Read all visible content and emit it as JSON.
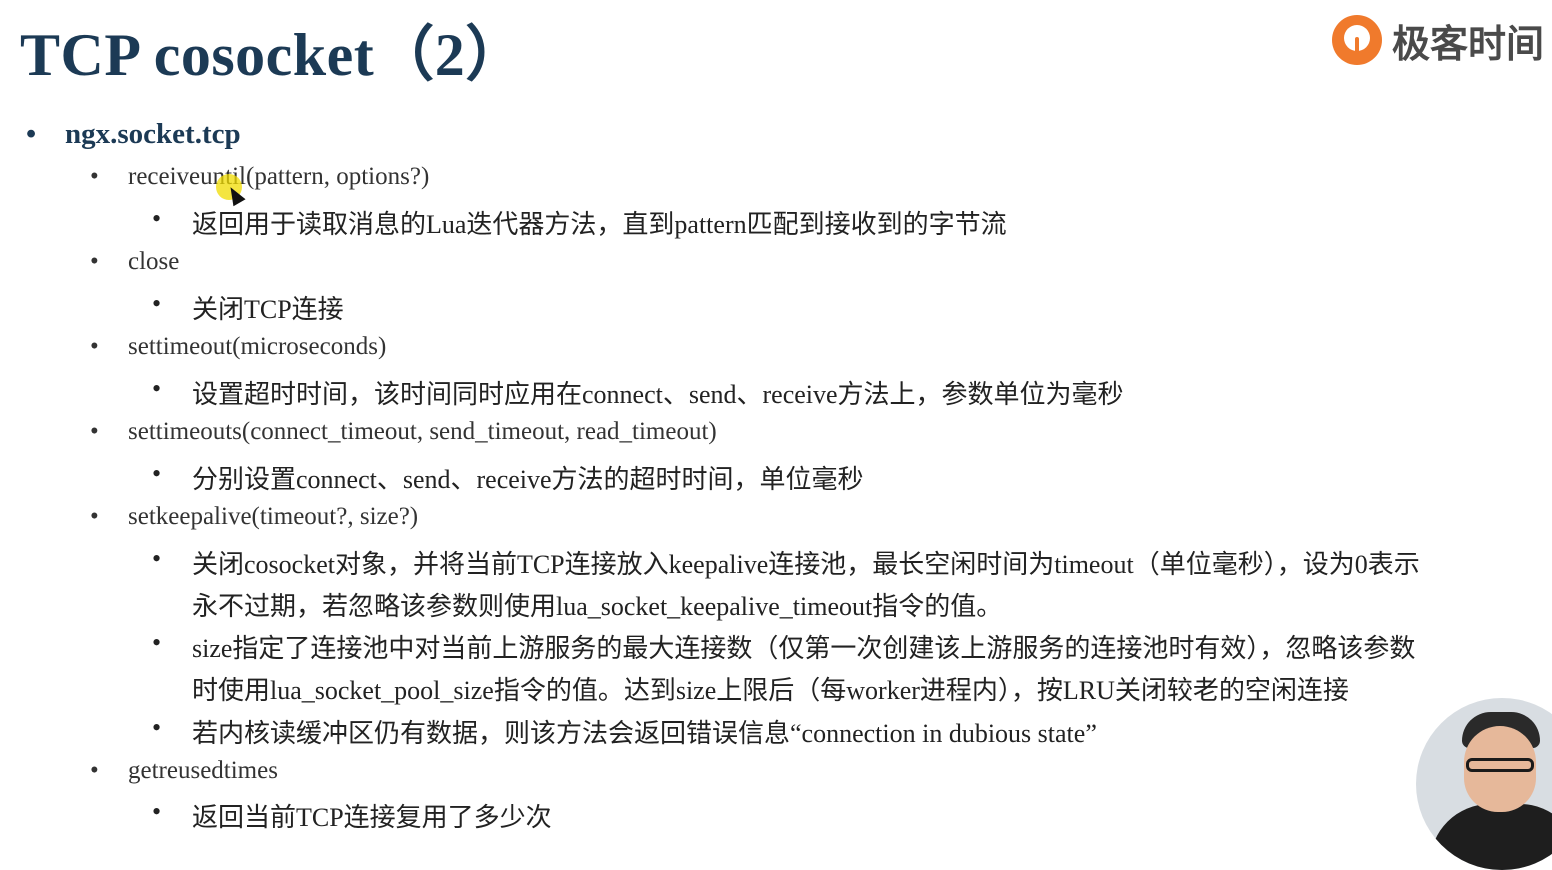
{
  "title": "TCP cosocket（2）",
  "logo": {
    "icon": "geektime-logo-icon",
    "text": "极客时间"
  },
  "bullet_glyph": "•",
  "level1": {
    "label": "ngx.socket.tcp"
  },
  "items": [
    {
      "method": "receiveuntil(pattern, options?)",
      "desc": [
        "返回用于读取消息的Lua迭代器方法，直到pattern匹配到接收到的字节流"
      ]
    },
    {
      "method": "close",
      "desc": [
        "关闭TCP连接"
      ]
    },
    {
      "method": "settimeout(microseconds)",
      "desc": [
        "设置超时时间，该时间同时应用在connect、send、receive方法上，参数单位为毫秒"
      ]
    },
    {
      "method": "settimeouts(connect_timeout, send_timeout, read_timeout)",
      "desc": [
        "分别设置connect、send、receive方法的超时时间，单位毫秒"
      ]
    },
    {
      "method": "setkeepalive(timeout?, size?)",
      "desc": [
        {
          "line1": "关闭cosocket对象，并将当前TCP连接放入keepalive连接池，最长空闲时间为timeout（单位毫秒），设为0表示",
          "line2": "永不过期，若忽略该参数则使用lua_socket_keepalive_timeout指令的值。"
        },
        {
          "line1": "size指定了连接池中对当前上游服务的最大连接数（仅第一次创建该上游服务的连接池时有效），忽略该参数",
          "line2": "时使用lua_socket_pool_size指令的值。达到size上限后（每worker进程内），按LRU关闭较老的空闲连接"
        },
        "若内核读缓冲区仍有数据，则该方法会返回错误信息“connection in dubious state”"
      ]
    },
    {
      "method": "getreusedtimes",
      "desc": [
        "返回当前TCP连接复用了多少次"
      ]
    }
  ],
  "colors": {
    "title": "#1c3a55",
    "logo_accent": "#f07a2c",
    "cursor_highlight": "#f0dc00"
  }
}
